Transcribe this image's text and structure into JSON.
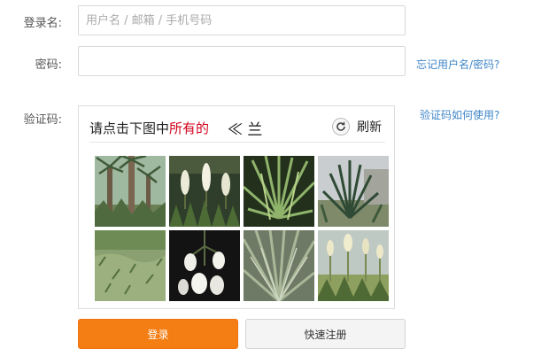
{
  "form": {
    "username_label": "登录名:",
    "username_placeholder": "用户名 / 邮箱 / 手机号码",
    "password_label": "密码:",
    "forgot_link": "忘记用户名/密码?",
    "captcha_label": "验证码:",
    "captcha_help_link": "验证码如何使用?"
  },
  "captcha": {
    "instruction_prefix": "请点击下图中",
    "instruction_emphasis": "所有的",
    "target_glyph": "≪ 兰",
    "refresh_label": "刷新",
    "emphasis_color": "#d0021b",
    "tiles": [
      {
        "name": "tile-yucca-trunks",
        "icon": "plant-photo"
      },
      {
        "name": "tile-yucca-flowers",
        "icon": "plant-photo"
      },
      {
        "name": "tile-yucca-spiky",
        "icon": "plant-photo"
      },
      {
        "name": "tile-yucca-clump",
        "icon": "plant-photo"
      },
      {
        "name": "tile-grass-ground",
        "icon": "plant-photo"
      },
      {
        "name": "tile-white-bells",
        "icon": "plant-photo"
      },
      {
        "name": "tile-spiky-close",
        "icon": "plant-photo"
      },
      {
        "name": "tile-flower-stalks",
        "icon": "plant-photo"
      }
    ]
  },
  "buttons": {
    "login_label": "登录",
    "register_label": "快速注册",
    "login_color": "#f57e14"
  }
}
